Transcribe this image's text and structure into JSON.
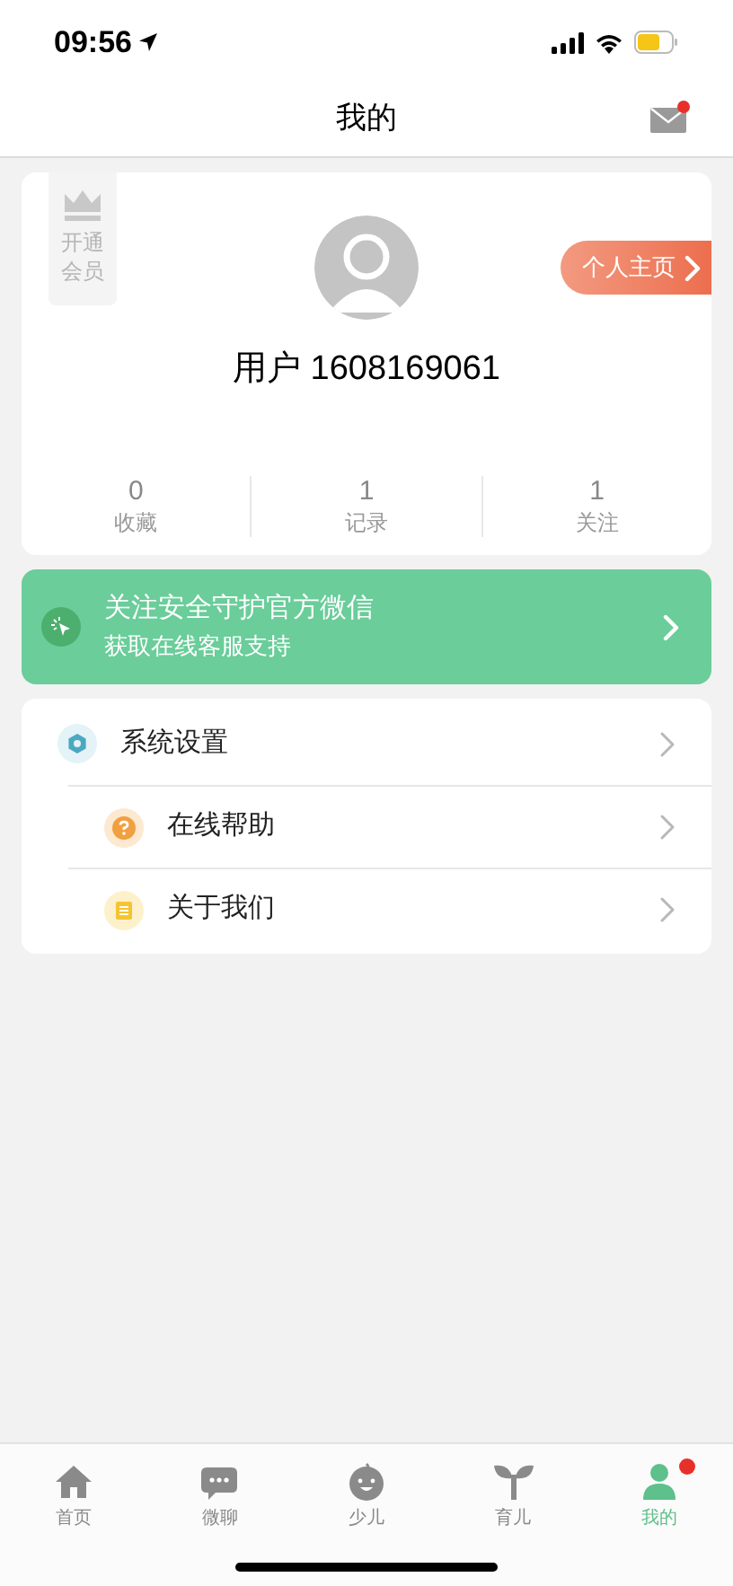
{
  "status_bar": {
    "time": "09:56"
  },
  "header": {
    "title": "我的",
    "mail_unread": true
  },
  "profile": {
    "vip_label": "开通会员",
    "username": "用户 1608169061",
    "homepage_button": "个人主页",
    "stats": [
      {
        "value": "0",
        "label": "收藏"
      },
      {
        "value": "1",
        "label": "记录"
      },
      {
        "value": "1",
        "label": "关注"
      }
    ]
  },
  "banner": {
    "title": "关注安全守护官方微信",
    "subtitle": "获取在线客服支持"
  },
  "menu": [
    {
      "kind": "settings",
      "label": "系统设置"
    },
    {
      "kind": "help",
      "label": "在线帮助"
    },
    {
      "kind": "about",
      "label": "关于我们"
    }
  ],
  "tab_bar": [
    {
      "kind": "home",
      "label": "首页",
      "selected": false,
      "badge": false
    },
    {
      "kind": "chat",
      "label": "微聊",
      "selected": false,
      "badge": false
    },
    {
      "kind": "child",
      "label": "少儿",
      "selected": false,
      "badge": false
    },
    {
      "kind": "sprout",
      "label": "育儿",
      "selected": false,
      "badge": false
    },
    {
      "kind": "me",
      "label": "我的",
      "selected": true,
      "badge": true
    }
  ]
}
